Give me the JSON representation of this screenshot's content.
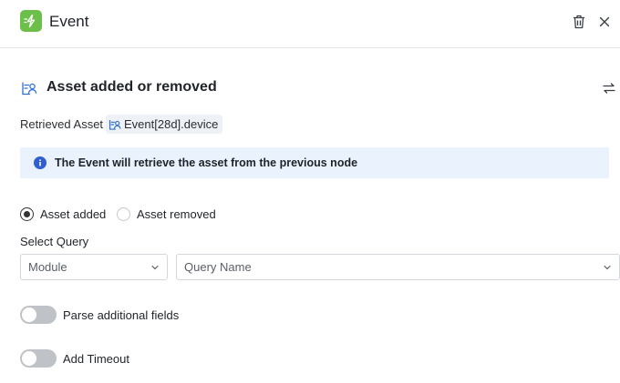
{
  "header": {
    "title": "Event",
    "app_icon": "event-bolt-icon",
    "accent": "#6cc04a",
    "actions": [
      "trash-icon",
      "close-icon"
    ]
  },
  "section": {
    "title": "Asset added or removed",
    "icon": "asset-icon",
    "action_icon": "swap-icon"
  },
  "retrieved": {
    "label": "Retrieved Asset",
    "value": "Event[28d].device",
    "icon": "asset-icon"
  },
  "info": {
    "text": "The Event will retrieve the asset from the previous node",
    "icon": "info-icon",
    "background": "#eaf2fd",
    "icon_color": "#2f5fd0"
  },
  "radios": {
    "options": [
      {
        "label": "Asset added",
        "selected": true
      },
      {
        "label": "Asset removed",
        "selected": false
      }
    ]
  },
  "query": {
    "label": "Select Query",
    "module_placeholder": "Module",
    "name_placeholder": "Query Name"
  },
  "toggles": [
    {
      "label": "Parse additional fields",
      "on": false
    },
    {
      "label": "Add Timeout",
      "on": false
    }
  ]
}
